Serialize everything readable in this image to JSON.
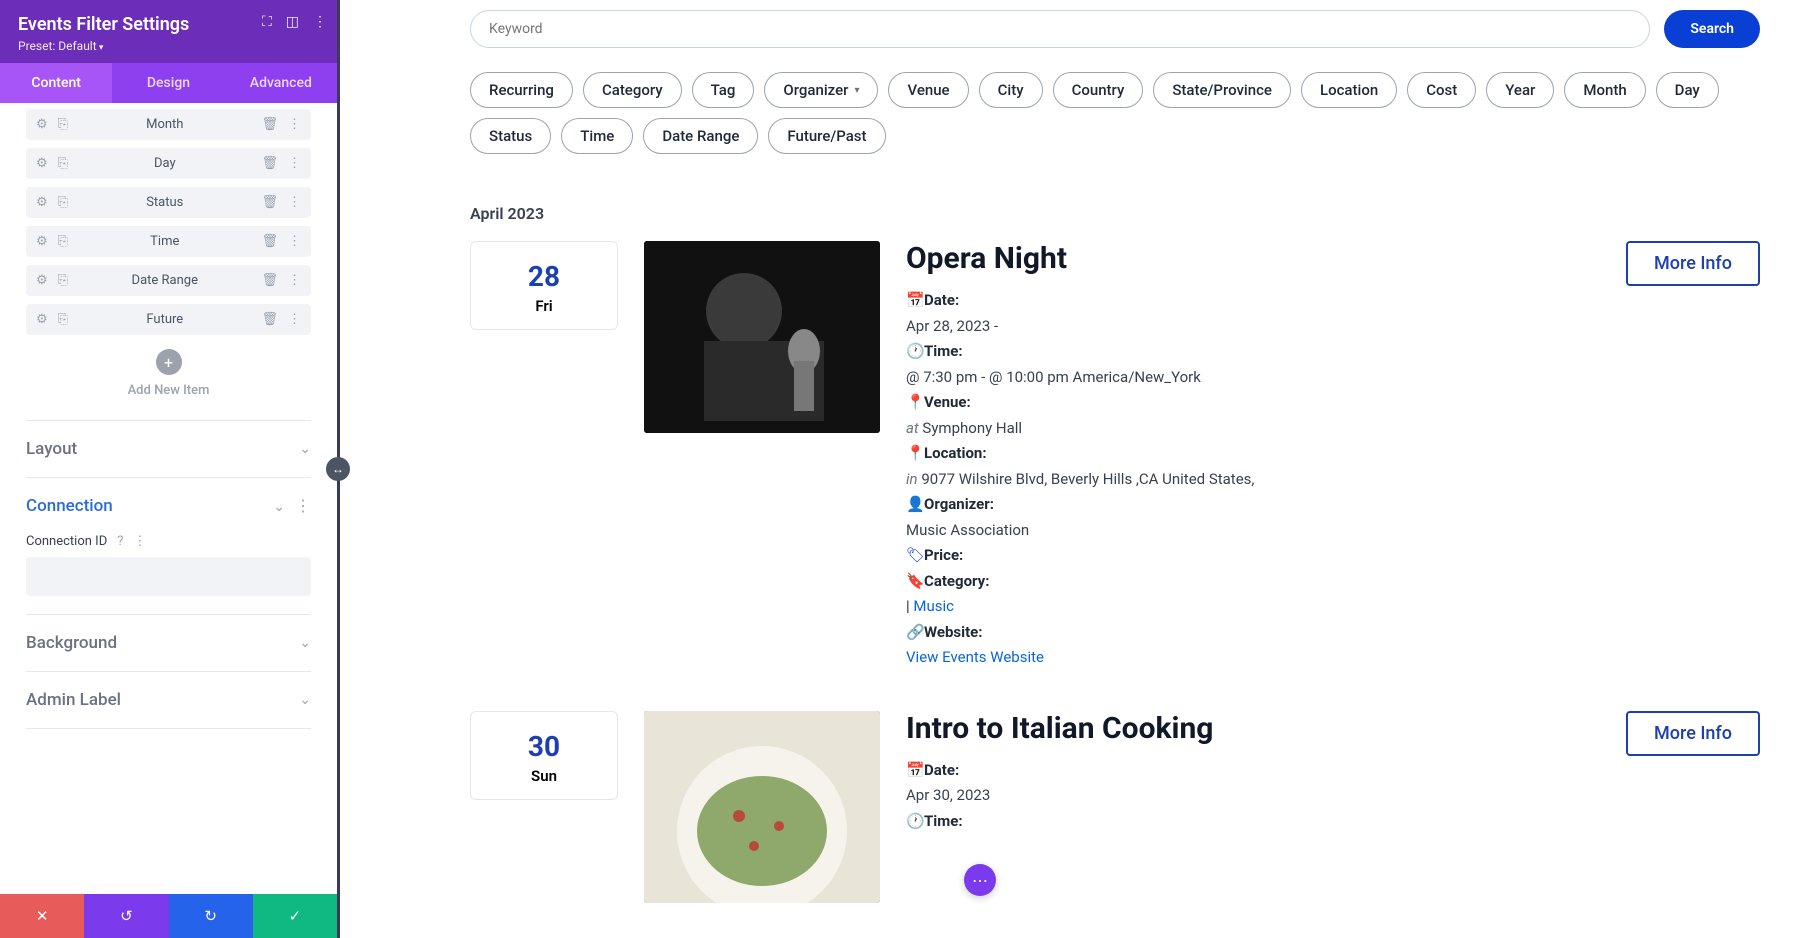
{
  "sidebar": {
    "title": "Events Filter Settings",
    "preset": "Preset: Default",
    "tabs": {
      "content": "Content",
      "design": "Design",
      "advanced": "Advanced"
    },
    "items": [
      {
        "label": "Month"
      },
      {
        "label": "Day"
      },
      {
        "label": "Status"
      },
      {
        "label": "Time"
      },
      {
        "label": "Date Range"
      },
      {
        "label": "Future"
      }
    ],
    "add_label": "Add New Item",
    "sections": {
      "layout": "Layout",
      "connection": "Connection",
      "background": "Background",
      "admin_label": "Admin Label"
    },
    "connection_id_label": "Connection ID",
    "connection_value": ""
  },
  "search": {
    "placeholder": "Keyword",
    "button": "Search"
  },
  "chips": [
    "Recurring",
    "Category",
    "Tag",
    "Organizer",
    "Venue",
    "City",
    "Country",
    "State/Province",
    "Location",
    "Cost",
    "Year",
    "Month",
    "Day",
    "Status",
    "Time",
    "Date Range",
    "Future/Past"
  ],
  "month_header": "April 2023",
  "labels": {
    "date": "Date:",
    "time": "Time:",
    "venue": "Venue:",
    "location": "Location:",
    "organizer": "Organizer:",
    "price": "Price:",
    "category": "Category:",
    "website": "Website:"
  },
  "more_info": "More Info",
  "events": [
    {
      "date_num": "28",
      "date_day": "Fri",
      "title": "Opera Night",
      "date_text": "Apr 28, 2023 -",
      "time_text": "@ 7:30 pm - @ 10:00 pm America/New_York",
      "venue_prefix": "at",
      "venue_text": "Symphony Hall",
      "loc_prefix": "in",
      "loc_text": "9077 Wilshire Blvd, Beverly Hills ,CA United States,",
      "organizer": "Music Association",
      "cat_prefix": "|",
      "category": "Music",
      "website": "View Events Website"
    },
    {
      "date_num": "30",
      "date_day": "Sun",
      "title": "Intro to Italian Cooking",
      "date_text": "Apr 30, 2023"
    }
  ]
}
